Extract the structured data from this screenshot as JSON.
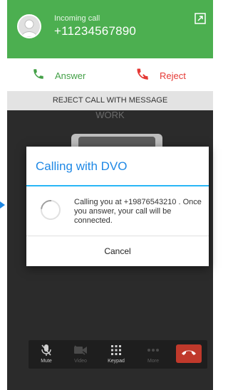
{
  "incoming_call": {
    "label": "Incoming call",
    "number": "+11234567890"
  },
  "actions": {
    "answer_label": "Answer",
    "reject_label": "Reject",
    "reject_with_message_label": "REJECT CALL WITH MESSAGE"
  },
  "contact": {
    "label": "WORK"
  },
  "dialog": {
    "title": "Calling with DVO",
    "message": "Calling you at +19876543210 . Once you answer, your call will be connected.",
    "cancel_label": "Cancel"
  },
  "controls": {
    "mute_label": "Mute",
    "video_label": "Video",
    "keypad_label": "Keypad",
    "more_label": "More"
  },
  "colors": {
    "header_green": "#4caf50",
    "answer_green": "#43a047",
    "reject_red": "#e53935",
    "dialog_accent": "#1e88e5",
    "end_call_red": "#c0392b"
  },
  "icons": {
    "avatar": "person-avatar-icon",
    "expand": "expand-icon",
    "answer": "phone-answer-icon",
    "reject": "phone-reject-icon",
    "mute": "mic-off-icon",
    "video": "video-off-icon",
    "keypad": "keypad-icon",
    "more": "more-dots-icon",
    "end_call": "end-call-icon"
  }
}
